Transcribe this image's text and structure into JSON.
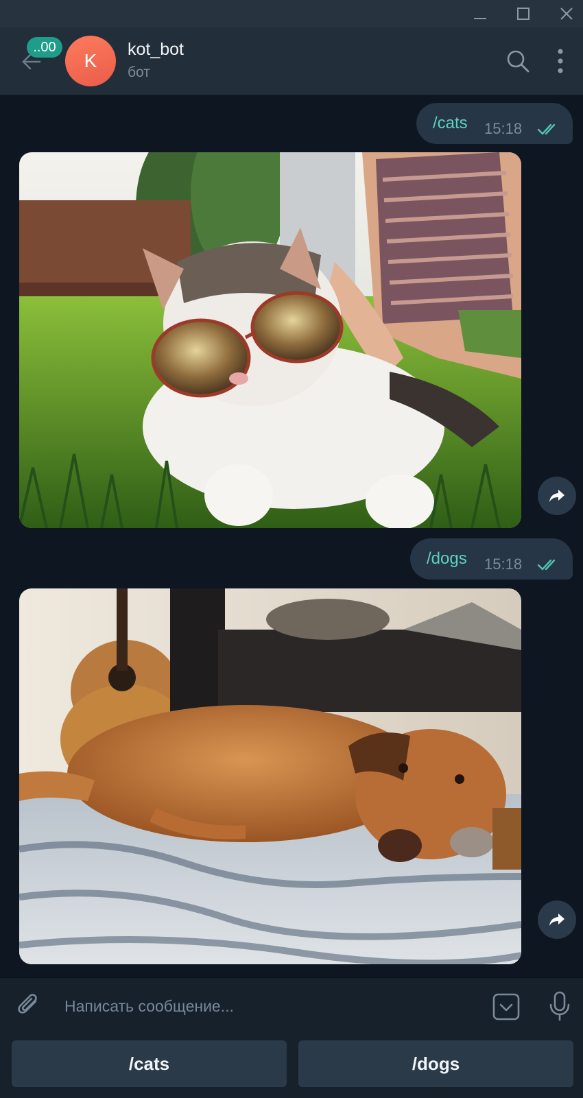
{
  "window": {
    "controls": [
      "minimize-icon",
      "maximize-icon",
      "close-icon"
    ]
  },
  "header": {
    "back_icon": "arrow-left-icon",
    "unread_badge": "..00",
    "avatar_letter": "K",
    "avatar_color": "#f06b55",
    "chat_name": "kot_bot",
    "chat_status": "бот",
    "search_icon": "search-icon",
    "menu_icon": "more-vertical-icon"
  },
  "messages": [
    {
      "type": "outgoing-command",
      "text": "/cats",
      "time": "15:18",
      "status_icon": "double-check-icon"
    },
    {
      "type": "incoming-photo",
      "photo_subject": "cat",
      "forward_icon": "share-icon"
    },
    {
      "type": "outgoing-command",
      "text": "/dogs",
      "time": "15:18",
      "status_icon": "double-check-icon"
    },
    {
      "type": "incoming-photo",
      "photo_subject": "dog",
      "forward_icon": "share-icon"
    }
  ],
  "composer": {
    "attach_icon": "paperclip-icon",
    "placeholder": "Написать сообщение...",
    "keyboard_icon": "keyboard-toggle-icon",
    "mic_icon": "microphone-icon"
  },
  "bot_keyboard": {
    "buttons": [
      "/cats",
      "/dogs"
    ]
  },
  "colors": {
    "accent": "#5ed1c4",
    "background": "#0e1621",
    "bubble": "#263646"
  }
}
